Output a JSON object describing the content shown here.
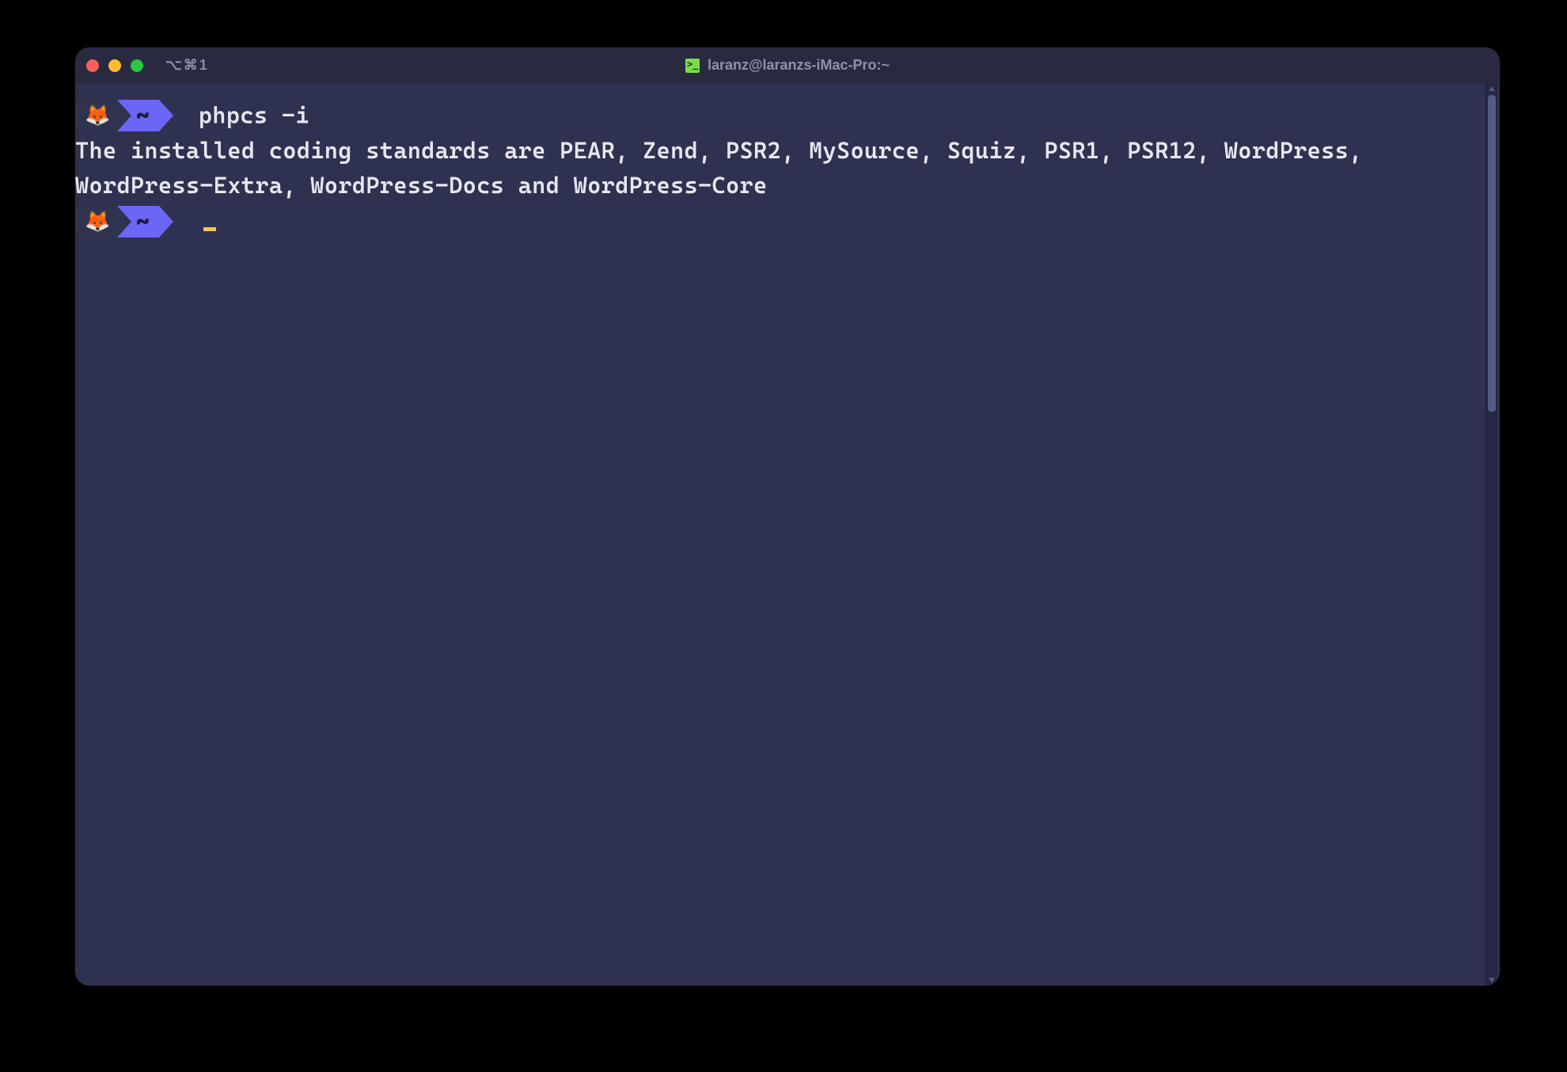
{
  "titlebar": {
    "tab_label": "⌥⌘1",
    "title": "laranz@laranzs-iMac-Pro:~"
  },
  "terminal": {
    "prompt_icon": "🦊",
    "prompt_cwd": "~",
    "command": "phpcs -i",
    "output": "The installed coding standards are PEAR, Zend, PSR2, MySource, Squiz, PSR1, PSR12, WordPress, WordPress-Extra, WordPress-Docs and WordPress-Core"
  }
}
